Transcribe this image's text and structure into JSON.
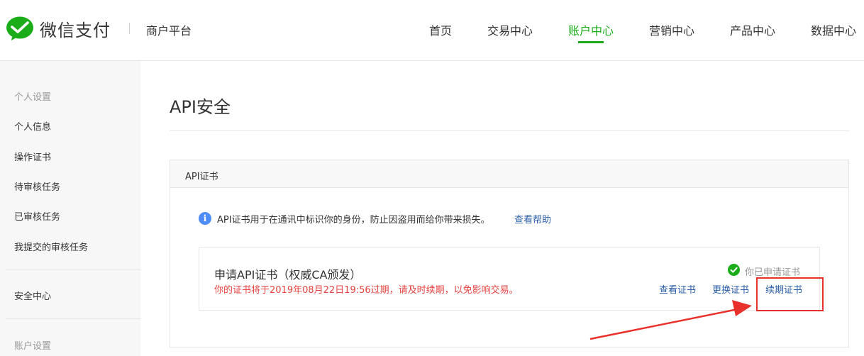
{
  "header": {
    "logo_text": "微信支付",
    "platform": "商户平台",
    "nav": [
      {
        "label": "首页"
      },
      {
        "label": "交易中心"
      },
      {
        "label": "账户中心"
      },
      {
        "label": "营销中心"
      },
      {
        "label": "产品中心"
      },
      {
        "label": "数据中心"
      }
    ],
    "active_nav": "账户中心"
  },
  "sidebar": {
    "group1": "个人设置",
    "items": [
      {
        "label": "个人信息"
      },
      {
        "label": "操作证书"
      },
      {
        "label": "待审核任务"
      },
      {
        "label": "已审核任务"
      },
      {
        "label": "我提交的审核任务"
      }
    ],
    "security": "安全中心",
    "group2": "账户设置"
  },
  "main": {
    "title": "API安全",
    "panel_title": "API证书",
    "info_text": "API证书用于在通讯中标识你的身份，防止因盗用而给你带来损失。",
    "help_link": "查看帮助",
    "cert": {
      "title": "申请API证书（权威CA颁发）",
      "warning": "你的证书将于2019年08月22日19:56过期，请及时续期，以免影响交易。",
      "status": "你已申请证书",
      "actions": {
        "view": "查看证书",
        "replace": "更换证书",
        "renew": "续期证书"
      }
    }
  },
  "colors": {
    "brand_green": "#1aad19",
    "link_blue": "#2a5ea7",
    "warning_red": "#e64340",
    "annotation_red": "#e8312c",
    "info_blue": "#4e8df7"
  },
  "icons": {
    "logo": "wechat-pay-logo-icon",
    "info": "info-icon",
    "status": "check-circle-icon"
  }
}
